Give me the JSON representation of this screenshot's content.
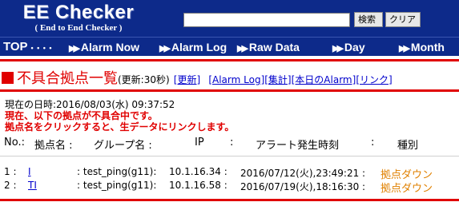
{
  "header": {
    "logo_title": "EE Checker",
    "logo_subtitle": "( End to End Checker )",
    "search_value": "",
    "search_button": "検索",
    "clear_button": "クリア"
  },
  "nav": {
    "top": "TOP",
    "top_dots": "• • • •",
    "items": [
      {
        "arrows": "▶▶",
        "label": "Alarm Now"
      },
      {
        "arrows": "▶▶",
        "label": "Alarm Log"
      },
      {
        "arrows": "▶▶",
        "label": "Raw Data"
      },
      {
        "arrows": "▶▶",
        "label": "Day"
      },
      {
        "arrows": "▶▶",
        "label": "Month"
      }
    ]
  },
  "page": {
    "title": "不具合拠点一覧",
    "update_note": "(更新:30秒)",
    "links": [
      "[更新]",
      "[Alarm Log]",
      "[集計]",
      "[本日のAlarm]",
      "[リンク]"
    ]
  },
  "content": {
    "current_time": "現在の日時:2016/08/03(水) 09:37:52",
    "alert_line_1": "現在、以下の拠点が不具合中です。",
    "alert_line_2": "拠点名をクリックすると、生データにリンクします。",
    "columns": {
      "no": "No.:",
      "site": "拠点名 :",
      "group": "グループ名 :",
      "ip": "IP",
      "sep": ":",
      "alert_time": "アラート発生時刻",
      "sep2": ":",
      "type": "種別"
    }
  },
  "rows": [
    {
      "no": "1 :",
      "site": "I",
      "group": ": test_ping(g11):",
      "ip": "10.1.16.34 :",
      "time": "2016/07/12(火),23:49:21 :",
      "type": "拠点ダウン"
    },
    {
      "no": "2 :",
      "site": "TI",
      "group": ": test_ping(g11):",
      "ip": "10.1.16.58 :",
      "time": "2016/07/19(火),18:16:30 :",
      "type": "拠点ダウン"
    }
  ],
  "colors": {
    "header_bg": "#0d2a8a",
    "accent_red": "#e00000",
    "link_blue": "#0000cc",
    "status_orange": "#e08000"
  }
}
